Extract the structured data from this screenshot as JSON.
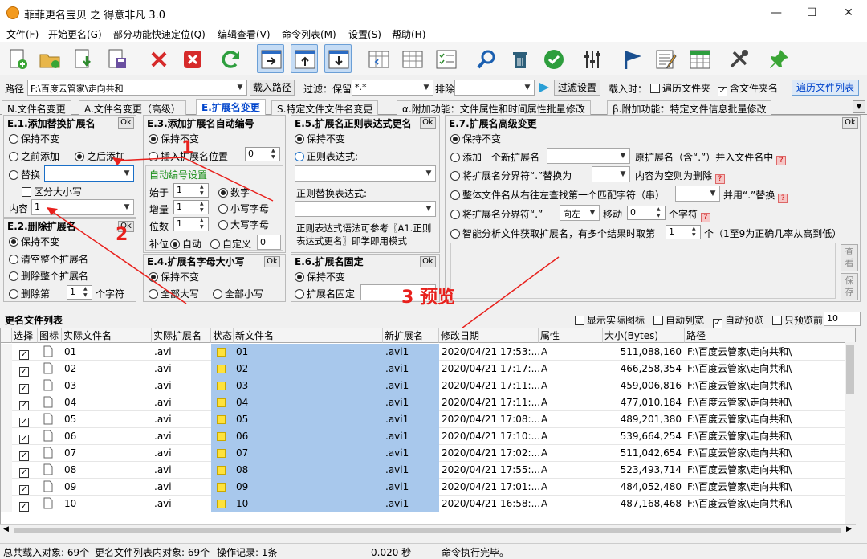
{
  "window": {
    "title": "菲菲更名宝贝 之 得意非凡 3.0",
    "min": "—",
    "max": "☐",
    "close": "✕"
  },
  "menu": [
    "文件(F)",
    "开始更名(G)",
    "部分功能快速定位(Q)",
    "编辑查看(V)",
    "命令列表(M)",
    "设置(S)",
    "帮助(H)"
  ],
  "toolbar_icons": [
    "new-file-icon",
    "open-folder-icon",
    "import-icon",
    "save-icon",
    "delete-icon",
    "clear-icon",
    "refresh-icon",
    "move-right-icon",
    "move-up-icon",
    "move-down-icon",
    "column-left-icon",
    "column-table-icon",
    "checklist-icon",
    "search-icon",
    "trash-icon",
    "confirm-icon",
    "equalizer-icon",
    "flag-icon",
    "edit-list-icon",
    "grid-edit-icon",
    "tools-icon",
    "pin-icon"
  ],
  "pathrow": {
    "path_label": "路径",
    "path_value": "F:\\百度云管家\\走向共和",
    "load_path": "载入路径",
    "filter_label": "过滤：保留",
    "filter_value": "*.*",
    "exclude_label": "排除",
    "exclude_value": "",
    "filter_settings": "过滤设置",
    "load_when": "载入时：",
    "traverse_folder": "遍历文件夹",
    "include_folder_name": "含文件夹名",
    "traverse_list": "遍历文件列表"
  },
  "tabs": [
    "N.文件名变更",
    "A.文件名变更（高级）",
    "E.扩展名变更",
    "S.特定文件文件名变更",
    "α.附加功能：文件属性和时间属性批量修改",
    "β.附加功能：特定文件信息批量修改"
  ],
  "ok": "Ok",
  "e1": {
    "title": "E.1.添加替换扩展名",
    "keep": "保持不变",
    "before": "之前添加",
    "after": "之后添加",
    "replace": "替换",
    "replace_value": "",
    "case": "区分大小写",
    "content_label": "内容",
    "content_value": "1"
  },
  "e2": {
    "title": "E.2.删除扩展名",
    "keep": "保持不变",
    "clear": "清空整个扩展名",
    "delete_all": "删除整个扩展名",
    "delete_nth": "删除第",
    "n": "1",
    "chars": "个字符"
  },
  "e3": {
    "title": "E.3.添加扩展名自动编号",
    "keep": "保持不变",
    "insert": "插入扩展名位置",
    "insert_pos": "0",
    "auto_title": "自动编号设置",
    "start_label": "始于",
    "start": "1",
    "step_label": "增量",
    "step": "1",
    "digits_label": "位数",
    "digits": "1",
    "pad_label": "补位",
    "auto": "自动",
    "custom": "自定义",
    "custom_value": "0",
    "digit": "数字",
    "lower": "小写字母",
    "upper": "大写字母"
  },
  "e4": {
    "title": "E.4.扩展名字母大小写",
    "keep": "保持不变",
    "all_upper": "全部大写",
    "all_lower": "全部小写"
  },
  "e5": {
    "title": "E.5.扩展名正则表达式更名",
    "keep": "保持不变",
    "regex": "正则表达式:",
    "regex_replace": "正则替换表达式:",
    "note": "正则表达式语法可参考〖A1.正则表达式更名〗即学即用模式"
  },
  "e6": {
    "title": "E.6.扩展名固定",
    "keep": "保持不变",
    "fixed": "扩展名固定"
  },
  "e7": {
    "title": "E.7.扩展名高级变更",
    "keep": "保持不变",
    "opt1a": "添加一个新扩展名",
    "opt1b": "原扩展名（含“.”）并入文件名中",
    "opt2a": "将扩展名分界符“.”替换为",
    "opt2b": "内容为空则为删除",
    "opt3a": "整体文件名从右往左查找第一个匹配字符（串）",
    "opt3b": "并用“.”替换",
    "opt4a": "将扩展名分界符“.”",
    "opt4_dir": "向左",
    "opt4_move": "移动",
    "opt4_n": "0",
    "opt4_chars": "个字符",
    "opt5a": "智能分析文件获取扩展名，有多个结果时取第",
    "opt5_n": "1",
    "opt5b": "个（1至9为正确几率从高到低）",
    "view": "查看",
    "save": "保存"
  },
  "annotations": {
    "a1": "1",
    "a2": "2",
    "a3": "3 预览"
  },
  "list": {
    "title": "更名文件列表",
    "show_icon": "显示实际图标",
    "auto_width": "自动列宽",
    "auto_preview": "自动预览",
    "preview_first": "只预览前",
    "preview_n": "10"
  },
  "columns": [
    "选择",
    "图标",
    "实际文件名",
    "实际扩展名",
    "状态",
    "新文件名",
    "新扩展名",
    "修改日期",
    "属性",
    "大小(Bytes)",
    "路径"
  ],
  "rows": [
    {
      "name": "01",
      "ext": ".avi",
      "new": "01",
      "newext": ".avi1",
      "date": "2020/04/21 17:53:...",
      "attr": "A",
      "size": "511,088,160",
      "path": "F:\\百度云管家\\走向共和\\"
    },
    {
      "name": "02",
      "ext": ".avi",
      "new": "02",
      "newext": ".avi1",
      "date": "2020/04/21 17:17:...",
      "attr": "A",
      "size": "466,258,354",
      "path": "F:\\百度云管家\\走向共和\\"
    },
    {
      "name": "03",
      "ext": ".avi",
      "new": "03",
      "newext": ".avi1",
      "date": "2020/04/21 17:11:...",
      "attr": "A",
      "size": "459,006,816",
      "path": "F:\\百度云管家\\走向共和\\"
    },
    {
      "name": "04",
      "ext": ".avi",
      "new": "04",
      "newext": ".avi1",
      "date": "2020/04/21 17:11:...",
      "attr": "A",
      "size": "477,010,184",
      "path": "F:\\百度云管家\\走向共和\\"
    },
    {
      "name": "05",
      "ext": ".avi",
      "new": "05",
      "newext": ".avi1",
      "date": "2020/04/21 17:08:...",
      "attr": "A",
      "size": "489,201,380",
      "path": "F:\\百度云管家\\走向共和\\"
    },
    {
      "name": "06",
      "ext": ".avi",
      "new": "06",
      "newext": ".avi1",
      "date": "2020/04/21 17:10:...",
      "attr": "A",
      "size": "539,664,254",
      "path": "F:\\百度云管家\\走向共和\\"
    },
    {
      "name": "07",
      "ext": ".avi",
      "new": "07",
      "newext": ".avi1",
      "date": "2020/04/21 17:02:...",
      "attr": "A",
      "size": "511,042,654",
      "path": "F:\\百度云管家\\走向共和\\"
    },
    {
      "name": "08",
      "ext": ".avi",
      "new": "08",
      "newext": ".avi1",
      "date": "2020/04/21 17:55:...",
      "attr": "A",
      "size": "523,493,714",
      "path": "F:\\百度云管家\\走向共和\\"
    },
    {
      "name": "09",
      "ext": ".avi",
      "new": "09",
      "newext": ".avi1",
      "date": "2020/04/21 17:01:...",
      "attr": "A",
      "size": "484,052,480",
      "path": "F:\\百度云管家\\走向共和\\"
    },
    {
      "name": "10",
      "ext": ".avi",
      "new": "10",
      "newext": ".avi1",
      "date": "2020/04/21 16:58:...",
      "attr": "A",
      "size": "487,168,468",
      "path": "F:\\百度云管家\\走向共和\\"
    }
  ],
  "status": {
    "total": "总共载入对象: 69个",
    "in_list": "更名文件列表内对象: 69个",
    "ops": "操作记录: 1条",
    "time": "0.020 秒",
    "msg": "命令执行完毕。"
  }
}
